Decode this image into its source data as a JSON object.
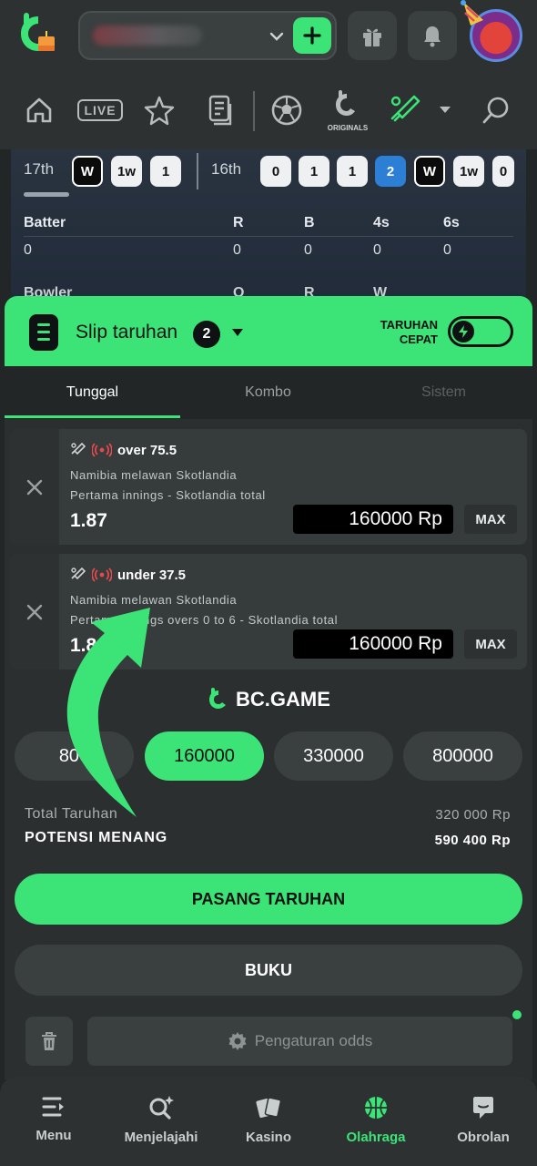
{
  "colors": {
    "accent": "#3ce377",
    "surface": "#2b2f2f",
    "live_red": "#e5484d",
    "ball_blue": "#2d7fd6"
  },
  "header": {
    "icons": [
      "bc-logo-icon",
      "chevron-down-icon",
      "plus-icon",
      "gift-icon",
      "bell-icon",
      "avatar"
    ]
  },
  "nav": {
    "live_label": "LIVE",
    "originals_label": "ORIGINALS",
    "icons": [
      "home-icon",
      "live-icon",
      "star-icon",
      "notes-icon",
      "soccer-ball-icon",
      "originals-icon",
      "cricket-bat-icon",
      "caret-down-icon",
      "search-icon"
    ]
  },
  "scoreboard": {
    "over_a": {
      "label": "17th",
      "balls": [
        "W",
        "1w",
        "1"
      ]
    },
    "over_b": {
      "label": "16th",
      "balls": [
        "0",
        "1",
        "1",
        "2",
        "W",
        "1w",
        "0"
      ]
    },
    "batter_headers": [
      "Batter",
      "R",
      "B",
      "4s",
      "6s"
    ],
    "batter_row": [
      "0",
      "0",
      "0",
      "0",
      "0"
    ],
    "bowler_headers": [
      "Bowler",
      "O",
      "R",
      "W"
    ]
  },
  "slip": {
    "title": "Slip taruhan",
    "count": "2",
    "quick_bet_label": "TARUHAN CEPAT",
    "tabs": [
      "Tunggal",
      "Kombo",
      "Sistem"
    ],
    "bets": [
      {
        "selection": "over 75.5",
        "match": "Namibia melawan Skotlandia",
        "market": "Pertama innings - Skotlandia total",
        "odds": "1.87",
        "stake": "160000 Rp",
        "max_label": "MAX"
      },
      {
        "selection": "under 37.5",
        "match": "Namibia melawan Skotlandia",
        "market": "Pertama innings overs 0 to 6 - Skotlandia total",
        "odds": "1.8",
        "stake": "160000 Rp",
        "max_label": "MAX"
      }
    ],
    "brand": "BC.GAME",
    "amounts": [
      "800",
      "160000",
      "330000",
      "800000"
    ],
    "selected_amount": "160000",
    "total_label": "Total Taruhan",
    "total_value": "320 000 Rp",
    "potential_label": "POTENSI MENANG",
    "potential_value": "590 400 Rp",
    "place_bet_label": "PASANG TARUHAN",
    "book_label": "BUKU",
    "odds_settings_label": "Pengaturan odds"
  },
  "bottom_nav": [
    {
      "label": "Menu",
      "icon": "menu-icon"
    },
    {
      "label": "Menjelajahi",
      "icon": "explore-icon"
    },
    {
      "label": "Kasino",
      "icon": "cards-icon"
    },
    {
      "label": "Olahraga",
      "icon": "basketball-icon"
    },
    {
      "label": "Obrolan",
      "icon": "chat-icon"
    }
  ],
  "bottom_nav_active": "Olahraga"
}
